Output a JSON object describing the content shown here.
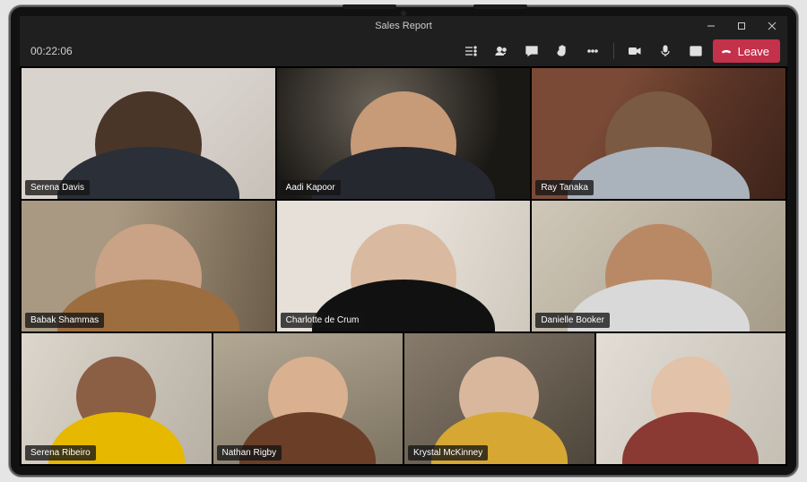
{
  "title": "Sales Report",
  "timer": "00:22:06",
  "leave_label": "Leave",
  "icons": {
    "participants": "participants-icon",
    "people": "people-icon",
    "chat": "chat-icon",
    "raise_hand": "raise-hand-icon",
    "more": "more-icon",
    "camera": "camera-icon",
    "mic": "mic-icon",
    "share": "share-icon",
    "hangup": "hangup-icon",
    "minimize": "minimize-icon",
    "maximize": "maximize-icon",
    "close": "close-icon"
  },
  "participants": [
    {
      "name": "Serena Davis"
    },
    {
      "name": "Aadi Kapoor"
    },
    {
      "name": "Ray Tanaka"
    },
    {
      "name": "Babak Shammas"
    },
    {
      "name": "Charlotte de Crum"
    },
    {
      "name": "Danielle Booker"
    },
    {
      "name": "Serena Ribeiro"
    },
    {
      "name": "Nathan Rigby"
    },
    {
      "name": "Krystal McKinney"
    },
    {
      "name": ""
    }
  ],
  "colors": {
    "leave_bg": "#c4314b",
    "bar_bg": "#1f1f1f"
  }
}
